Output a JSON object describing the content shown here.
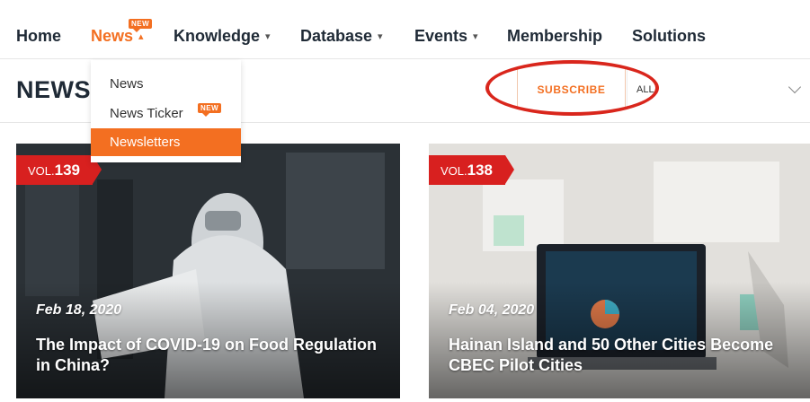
{
  "nav": {
    "items": [
      {
        "label": "Home",
        "caret": ""
      },
      {
        "label": "News",
        "caret": "▴"
      },
      {
        "label": "Knowledge",
        "caret": "▾"
      },
      {
        "label": "Database",
        "caret": "▾"
      },
      {
        "label": "Events",
        "caret": "▾"
      },
      {
        "label": "Membership",
        "caret": ""
      },
      {
        "label": "Solutions",
        "caret": ""
      }
    ],
    "new_badge": "NEW",
    "accent_color": "#f36f21"
  },
  "dropdown": {
    "items": [
      {
        "label": "News"
      },
      {
        "label": "News Ticker",
        "badge": "NEW"
      },
      {
        "label": "Newsletters"
      }
    ]
  },
  "section": {
    "title": "NEWS",
    "subscribe_label": "SUBSCRIBE",
    "filter_value": "ALL"
  },
  "cards": [
    {
      "vol_prefix": "VOL.",
      "vol_number": "139",
      "date": "Feb 18, 2020",
      "title": "The Impact of COVID-19 on Food Regulation in China?"
    },
    {
      "vol_prefix": "VOL.",
      "vol_number": "138",
      "date": "Feb 04, 2020",
      "title": "Hainan Island and 50 Other Cities Become CBEC Pilot Cities"
    }
  ]
}
